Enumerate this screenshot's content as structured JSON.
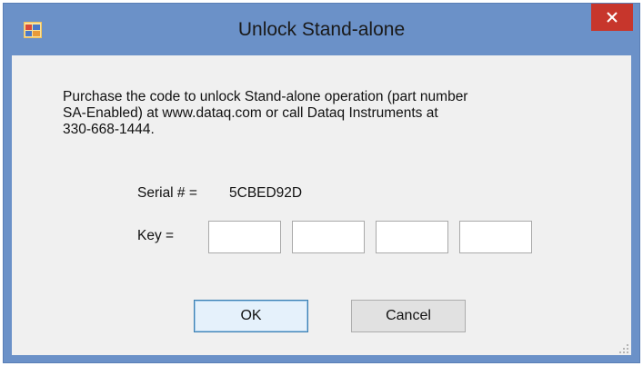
{
  "window": {
    "title": "Unlock Stand-alone",
    "close_symbol": "✕"
  },
  "message": {
    "line1": "Purchase the code to unlock Stand-alone operation (part number",
    "line2": "SA-Enabled) at www.dataq.com or call Dataq Instruments at",
    "line3": "330-668-1444."
  },
  "serial": {
    "label": "Serial # =",
    "value": "5CBED92D"
  },
  "key": {
    "label": "Key =",
    "fields": [
      "",
      "",
      "",
      ""
    ]
  },
  "buttons": {
    "ok": "OK",
    "cancel": "Cancel"
  },
  "icons": {
    "app": "app-window-icon",
    "close": "close-icon",
    "grip": "resize-grip-icon"
  },
  "colors": {
    "titlebar": "#6b91c8",
    "close_button": "#c7362c",
    "client_bg": "#f0f0f0",
    "ok_border": "#3c7fb1"
  }
}
